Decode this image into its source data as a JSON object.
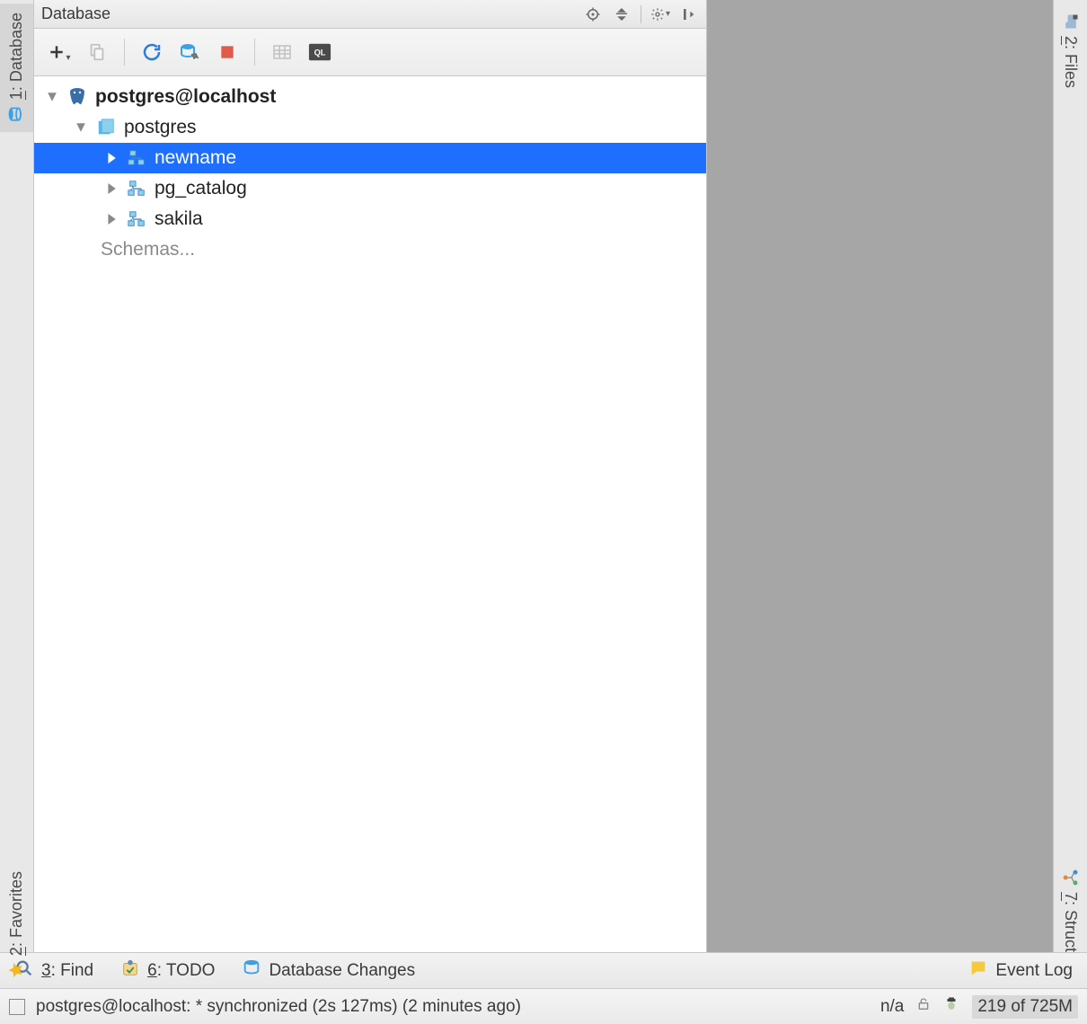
{
  "panel": {
    "title": "Database"
  },
  "left_sidebar": {
    "tabs": [
      {
        "num": "1",
        "label": "Database",
        "active": true
      },
      {
        "num": "2",
        "label": "Favorites",
        "active": false
      }
    ]
  },
  "right_sidebar": {
    "tabs": [
      {
        "num": "2",
        "label": "Files"
      },
      {
        "num": "7",
        "label": "Structure"
      }
    ]
  },
  "tree": {
    "datasource": "postgres@localhost",
    "database": "postgres",
    "schemas": [
      {
        "name": "newname",
        "selected": true
      },
      {
        "name": "pg_catalog",
        "selected": false
      },
      {
        "name": "sakila",
        "selected": false
      }
    ],
    "schemas_link": "Schemas..."
  },
  "bottom": {
    "find": {
      "num": "3",
      "label": "Find"
    },
    "todo": {
      "num": "6",
      "label": "TODO"
    },
    "dbchanges": "Database Changes",
    "eventlog": "Event Log"
  },
  "status": {
    "message": "postgres@localhost: * synchronized (2s 127ms) (2 minutes ago)",
    "enc": "n/a",
    "mem": "219 of 725M"
  }
}
